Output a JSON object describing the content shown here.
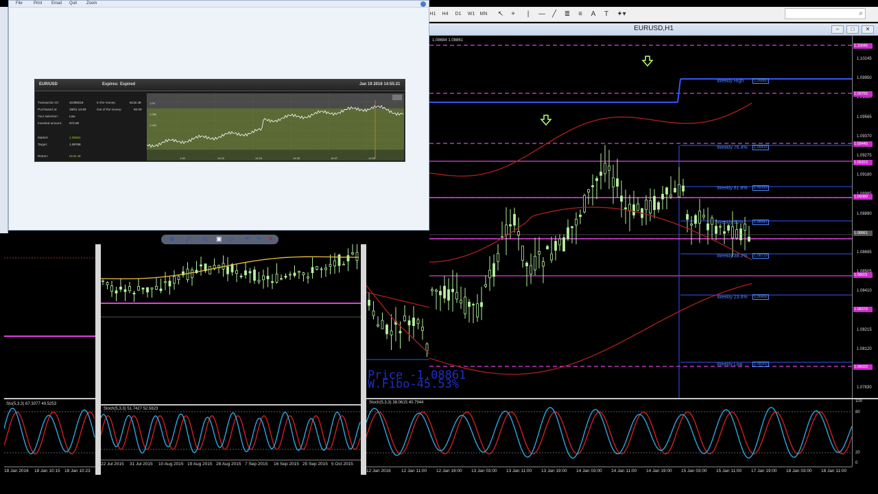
{
  "browser": {
    "menu": [
      "File",
      "Print",
      "Email",
      "Quit",
      "Zoom"
    ],
    "trade": {
      "symbol": "EUR/USD",
      "expires_label": "Expires:",
      "expires_value": "Expired",
      "datetime": "Jan 19 2016   14:55:21",
      "rows": [
        {
          "label": "Transaction ID:",
          "value": "41098319"
        },
        {
          "label": "Purchased at:",
          "value": "19/01 14:49"
        },
        {
          "label": "Your selection:",
          "value": "Low"
        },
        {
          "label": "Invested amount:",
          "value": "€72.00"
        }
      ],
      "right_rows": [
        {
          "label": "In the money:",
          "value": "€132.48"
        },
        {
          "label": "Out of the money:",
          "value": "€0.00"
        }
      ],
      "market_label": "Market:",
      "market_value": "1.09661",
      "target_label": "Target:",
      "target_value": "1.09768",
      "return_label": "Return:",
      "return_value": "€132.48",
      "chart_x": [
        "1:45",
        "14:22",
        "14:29",
        "14:35",
        "14:47",
        "14:53"
      ],
      "chart_y": [
        "1.09",
        "1.086",
        "1.082"
      ]
    }
  },
  "toolbar": {
    "timeframes": [
      "H1",
      "H4",
      "D1",
      "W1",
      "MN"
    ],
    "tools": [
      "cursor-icon",
      "crosshair-icon",
      "vline-icon",
      "hline-icon",
      "trendline-icon",
      "channel-icon",
      "fibo-icon",
      "text-icon",
      "label-icon",
      "shapes-icon"
    ]
  },
  "chart": {
    "title": "EURUSD,H1",
    "ohlc": "1.08684 1.08861",
    "price_axis": [
      "1.10245",
      "1.09950",
      "1.09660",
      "1.09565",
      "1.09370",
      "1.09275",
      "1.09180",
      "1.08985",
      "1.08890",
      "1.08795",
      "1.08695",
      "1.08505",
      "1.08410",
      "1.08310",
      "1.08215",
      "1.08120",
      "1.07925",
      "1.07830"
    ],
    "price_tags": [
      {
        "label": "1.10045",
        "color": "#cc2ccc"
      },
      {
        "label": "1.09755",
        "color": "#cc2ccc"
      },
      {
        "label": "1.09445",
        "color": "#cc2ccc"
      },
      {
        "label": "1.09323",
        "color": "#cc2ccc"
      },
      {
        "label": "1.09080",
        "color": "#cc2ccc"
      },
      {
        "label": "1.08861",
        "color": "#555555"
      },
      {
        "label": "1.08601",
        "color": "#cc2ccc"
      },
      {
        "label": "1.08379",
        "color": "#cc2ccc"
      },
      {
        "label": "1.08020",
        "color": "#cc2ccc"
      }
    ],
    "fibo": [
      {
        "label": "Weekly High",
        "value": "1.09880"
      },
      {
        "label": "Weekly 76.4%",
        "value": "1.09416"
      },
      {
        "label": "Weekly 61.8%",
        "value": "1.09153"
      },
      {
        "label": "Weekly 50%",
        "value": "1.08941"
      },
      {
        "label": "Weekly 38.2%",
        "value": "1.08729"
      },
      {
        "label": "Weekly 23.6%",
        "value": "1.08466"
      },
      {
        "label": "Weekly Low",
        "value": "1.08002"
      }
    ],
    "overlay_price": "Price -1.08861",
    "overlay_fibo": "W.Fibo-45.53%",
    "stoch_label": "Stoch(5,3,3) 38.0615 40.7944",
    "stoch_levels": [
      "100",
      "80",
      "20",
      "0"
    ],
    "time_axis": [
      "12 Jan 2016",
      "12 Jan 11:00",
      "12 Jan 19:00",
      "13 Jan 03:00",
      "13 Jan 11:00",
      "13 Jan 19:00",
      "14 Jan 03:00",
      "14 Jan 11:00",
      "14 Jan 19:00",
      "15 Jan 03:00",
      "15 Jan 11:00",
      "17 Jan 19:00",
      "18 Jan 03:00",
      "18 Jan 11:00"
    ]
  },
  "middle": {
    "stoch_label": "Stoch(5,3,3) 51.7427 52.5623",
    "time_axis": [
      "22 Jul 2015",
      "31 Jul 2015",
      "10 Aug 2015",
      "19 Aug 2015",
      "28 Aug 2015",
      "7 Sep 2015",
      "16 Sep 2015",
      "25 Sep 2015",
      "5 Oct 2015"
    ]
  },
  "left": {
    "stoch_label": "Sto(5,3,3) 67.3077 49.5253",
    "time_axis": [
      "18 Jan 2016",
      "18 Jan 10:15",
      "18 Jan 10:23"
    ]
  },
  "colors": {
    "candle": "#b7f0a0",
    "magenta": "#e040e0",
    "bollinger": "#b02020",
    "fibo": "#3355ff",
    "stoch_main": "#2ea8e0",
    "stoch_signal": "#d02020"
  }
}
